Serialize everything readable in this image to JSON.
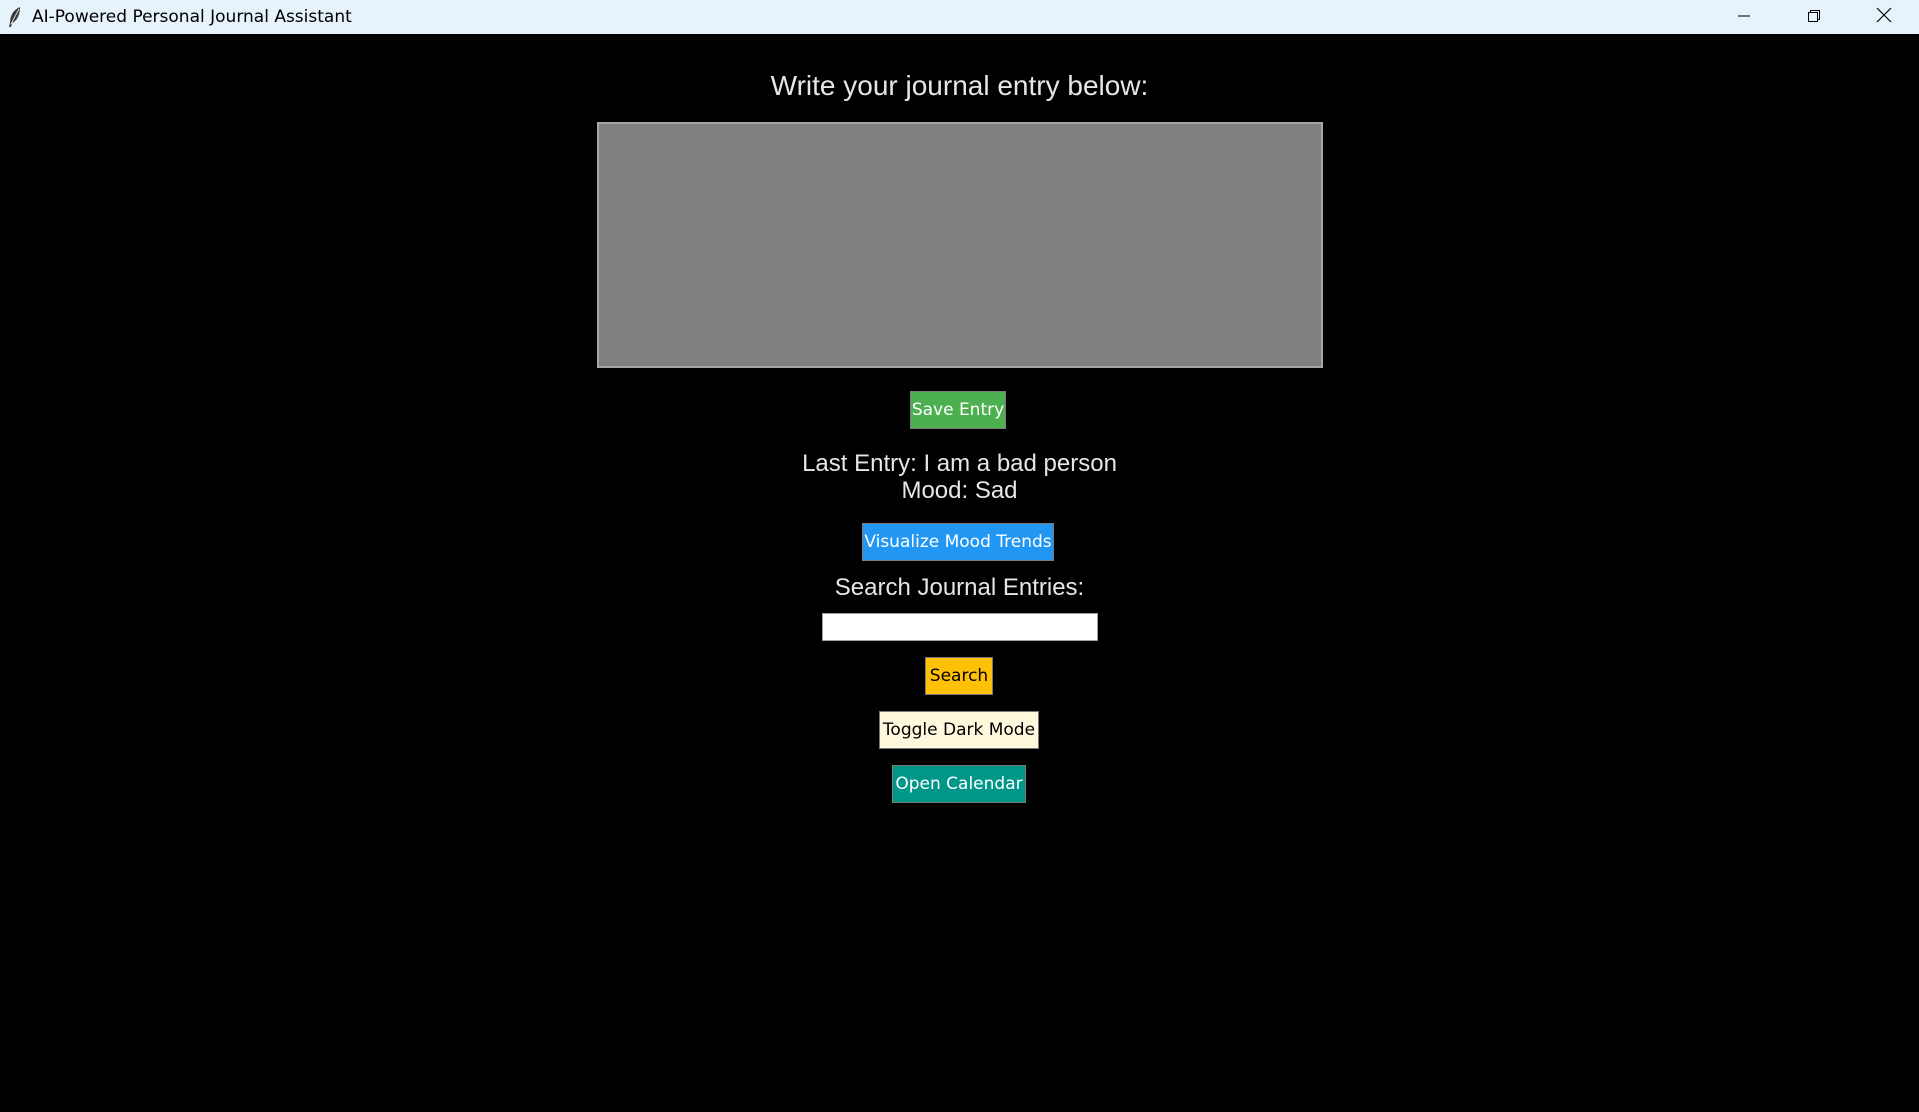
{
  "window": {
    "title": "AI-Powered Personal Journal Assistant",
    "app_icon": "feather-icon",
    "controls": [
      "minimize-icon",
      "restore-icon",
      "close-icon"
    ]
  },
  "main": {
    "heading": "Write your journal entry below:",
    "entry_text": "",
    "save_label": "Save Entry",
    "last_entry_line": "Last Entry: I am a bad person",
    "mood_line": "Mood: Sad",
    "visualize_label": "Visualize Mood Trends",
    "search_label": "Search Journal Entries:",
    "search_value": "",
    "search_button_label": "Search",
    "toggle_dark_label": "Toggle Dark Mode",
    "calendar_label": "Open Calendar"
  },
  "colors": {
    "background": "#000000",
    "titlebar": "#e6f3fa",
    "entry_area": "#808080",
    "save": "#4caf50",
    "visualize": "#2196f3",
    "search": "#ffc107",
    "toggle": "#fff8dc",
    "calendar": "#009688"
  }
}
